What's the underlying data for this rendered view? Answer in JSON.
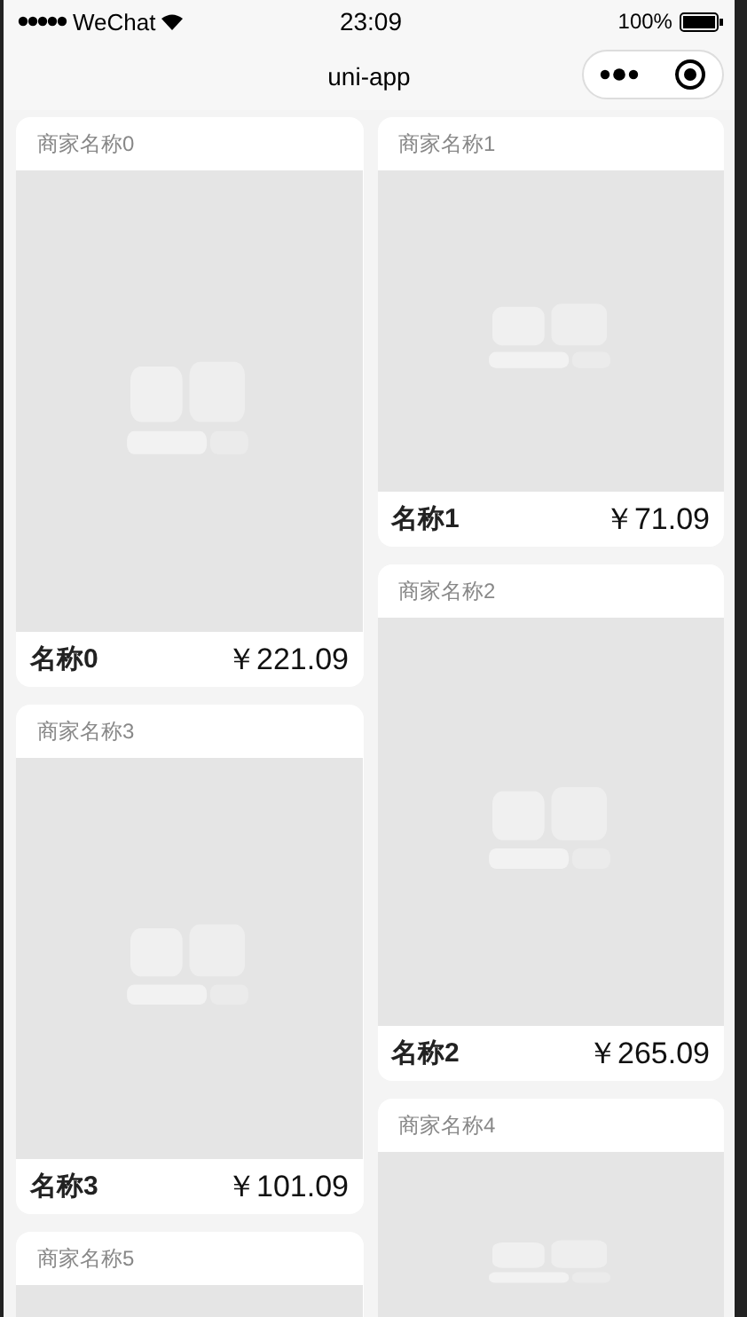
{
  "status_bar": {
    "carrier": "WeChat",
    "time": "23:09",
    "battery": "100%"
  },
  "nav_bar": {
    "title": "uni-app"
  },
  "columns": [
    [
      {
        "shop": "商家名称0",
        "name": "名称0",
        "price": "￥221.09"
      },
      {
        "shop": "商家名称3",
        "name": "名称3",
        "price": "￥101.09"
      },
      {
        "shop": "商家名称5"
      }
    ],
    [
      {
        "shop": "商家名称1",
        "name": "名称1",
        "price": "￥71.09"
      },
      {
        "shop": "商家名称2",
        "name": "名称2",
        "price": "￥265.09"
      },
      {
        "shop": "商家名称4"
      }
    ]
  ]
}
